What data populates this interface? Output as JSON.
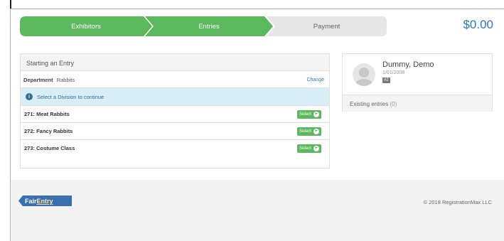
{
  "steps": [
    {
      "label": "Exhibitors",
      "state": "complete"
    },
    {
      "label": "Entries",
      "state": "active"
    },
    {
      "label": "Payment",
      "state": "upcoming"
    }
  ],
  "total": "$0.00",
  "entry": {
    "title": "Starting an Entry",
    "department_label": "Department",
    "department_value": "Rabbits",
    "change_label": "Change",
    "info_text": "Select a Division to continue",
    "divisions": [
      {
        "name": "271: Meat Rabbits",
        "button": "Select"
      },
      {
        "name": "272: Fancy Rabbits",
        "button": "Select"
      },
      {
        "name": "273: Costume Class",
        "button": "Select"
      }
    ]
  },
  "profile": {
    "name": "Dummy, Demo",
    "date": "1/01/2008",
    "badge": "#2",
    "existing_label": "Existing entries",
    "existing_count": "(0)"
  },
  "footer": {
    "logo_part1": "Fair",
    "logo_part2": "Entry",
    "copyright": "© 2018 RegistrationMax LLC"
  },
  "colors": {
    "step_green": "#5cb85c",
    "step_grey": "#e6e6e6",
    "accent_blue": "#2b78c2",
    "info_bg": "#d9edf7"
  }
}
